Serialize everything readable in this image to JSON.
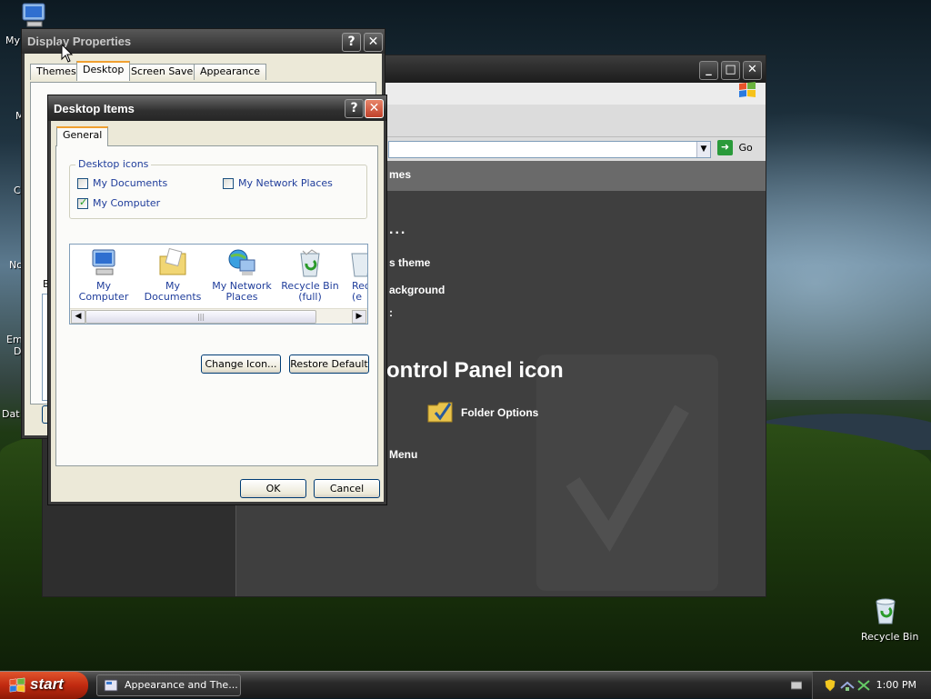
{
  "desktop": {
    "icons": [
      {
        "label": "My",
        "icon": "my-computer-icon"
      },
      {
        "label": "M"
      },
      {
        "label": "C"
      },
      {
        "label": "No"
      },
      {
        "label": "Em"
      },
      {
        "label": "D"
      },
      {
        "label": "Dat"
      }
    ],
    "recycle_bin_label": "Recycle Bin"
  },
  "explorer": {
    "go_label": "Go",
    "fragments": {
      "themes_header": "mes",
      "dots": "...",
      "theme_link": "s theme",
      "background_link": "ackground",
      "colon": ":",
      "control_panel_heading": "ontrol Panel icon",
      "folder_options": "Folder Options",
      "menu": "Menu"
    }
  },
  "display_properties": {
    "title": "Display Properties",
    "tabs": [
      "Themes",
      "Desktop",
      "Screen Saver",
      "Appearance"
    ],
    "active_tab": "Desktop",
    "fragment_b": "B"
  },
  "desktop_items": {
    "title": "Desktop Items",
    "tab": "General",
    "group_label": "Desktop icons",
    "checkboxes": [
      {
        "label": "My Documents",
        "checked": false
      },
      {
        "label": "My Network Places",
        "checked": false
      },
      {
        "label": "My Computer",
        "checked": true
      }
    ],
    "icons": [
      {
        "label": "My Computer",
        "icon": "my-computer-icon"
      },
      {
        "label": "My Documents",
        "icon": "my-documents-icon"
      },
      {
        "label": "My Network Places",
        "icon": "network-places-icon"
      },
      {
        "label": "Recycle Bin (full)",
        "icon": "recycle-bin-full-icon"
      },
      {
        "label": "Rec (e",
        "icon": "recycle-bin-empty-icon"
      }
    ],
    "change_icon_label": "Change Icon...",
    "restore_default_label": "Restore Default",
    "ok_label": "OK",
    "cancel_label": "Cancel"
  },
  "taskbar": {
    "start_label": "start",
    "task_label": "Appearance and The...",
    "clock": "1:00 PM"
  },
  "colors": {
    "xp_link_blue": "#1f3d9b",
    "close_red": "#c0402a",
    "start_orange": "#c12a10"
  }
}
